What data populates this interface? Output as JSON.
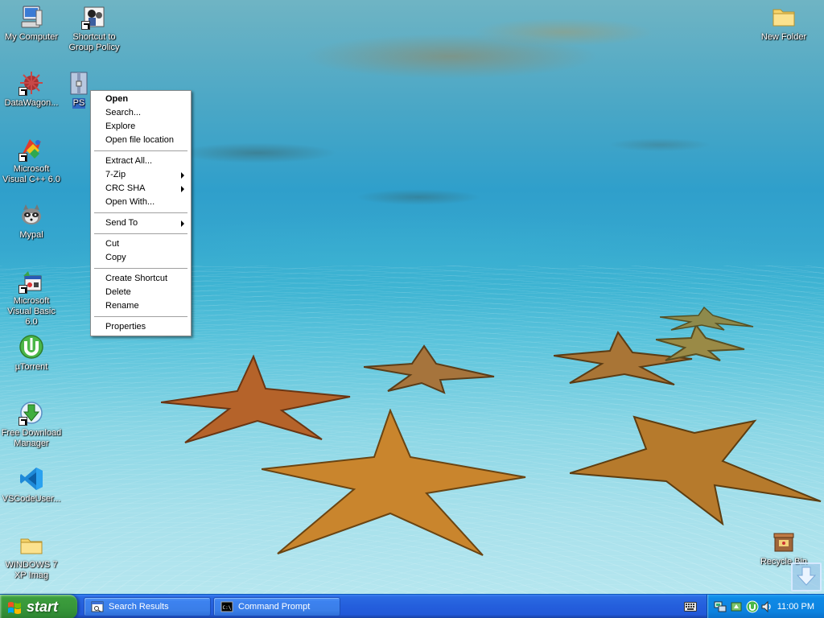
{
  "desktop": {
    "icons": [
      {
        "id": "my-computer",
        "label": "My Computer"
      },
      {
        "id": "gp-shortcut",
        "label": "Shortcut to Group Policy"
      },
      {
        "id": "datawagon",
        "label": "DataWagon..."
      },
      {
        "id": "ps-item",
        "label": "PS"
      },
      {
        "id": "msvc",
        "label": "Microsoft Visual C++ 6.0"
      },
      {
        "id": "mypal",
        "label": "Mypal"
      },
      {
        "id": "msvb",
        "label": "Microsoft Visual Basic 6.0"
      },
      {
        "id": "utorrent",
        "label": "µTorrent"
      },
      {
        "id": "fdm",
        "label": "Free Download Manager"
      },
      {
        "id": "vscode",
        "label": "VSCodeUser..."
      },
      {
        "id": "win7",
        "label": "WINDOWS 7 XP Imag"
      },
      {
        "id": "new-folder",
        "label": "New Folder"
      },
      {
        "id": "recycle-bin",
        "label": "Recycle Bin"
      }
    ]
  },
  "context_menu": {
    "items": [
      {
        "label": "Open"
      },
      {
        "label": "Search..."
      },
      {
        "label": "Explore"
      },
      {
        "label": "Open file location"
      },
      {
        "label": "Extract All..."
      },
      {
        "label": "7-Zip"
      },
      {
        "label": "CRC SHA"
      },
      {
        "label": "Open With..."
      },
      {
        "label": "Send To"
      },
      {
        "label": "Cut"
      },
      {
        "label": "Copy"
      },
      {
        "label": "Create Shortcut"
      },
      {
        "label": "Delete"
      },
      {
        "label": "Rename"
      },
      {
        "label": "Properties"
      }
    ]
  },
  "taskbar": {
    "start_label": "start",
    "buttons": [
      {
        "label": "Search Results"
      },
      {
        "label": "Command Prompt"
      }
    ],
    "clock": "11:00 PM"
  },
  "colors": {
    "taskbar_blue": "#245edc",
    "start_green": "#37963a",
    "tray_blue": "#0c82df",
    "selection_blue": "#316ac5"
  }
}
